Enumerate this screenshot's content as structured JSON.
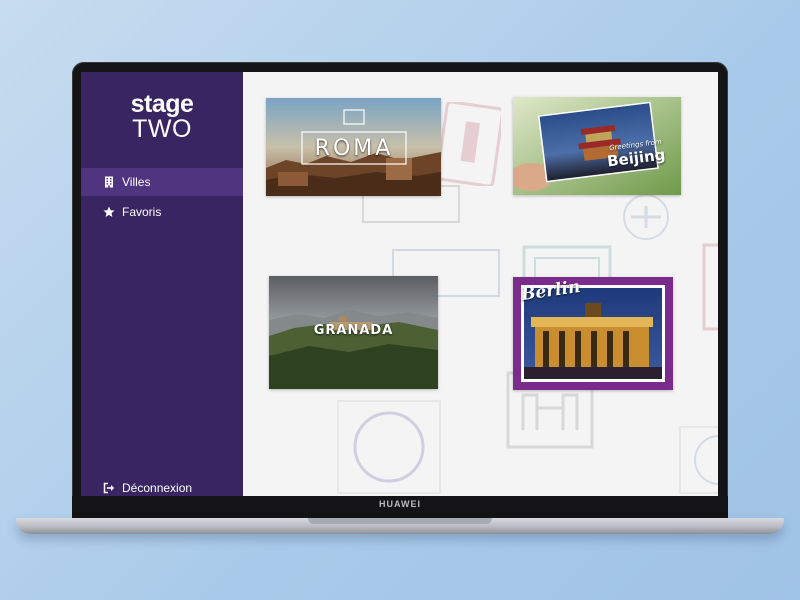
{
  "app": {
    "logo_line1": "stage",
    "logo_line2": "TWO"
  },
  "sidebar": {
    "items": [
      {
        "label": "Villes",
        "icon": "building-icon",
        "active": true
      },
      {
        "label": "Favoris",
        "icon": "star-icon",
        "active": false
      }
    ],
    "logout_label": "Déconnexion"
  },
  "cities": [
    {
      "name": "ROMA"
    },
    {
      "name": "Beijing",
      "caption": "Greetings from"
    },
    {
      "name": "GRANADA"
    },
    {
      "name": "Berlin"
    }
  ],
  "device": {
    "brand": "HUAWEI"
  },
  "colors": {
    "sidebar": "#3a2563",
    "sidebar_active": "#4f3480",
    "content_bg": "#f4f4f4"
  }
}
